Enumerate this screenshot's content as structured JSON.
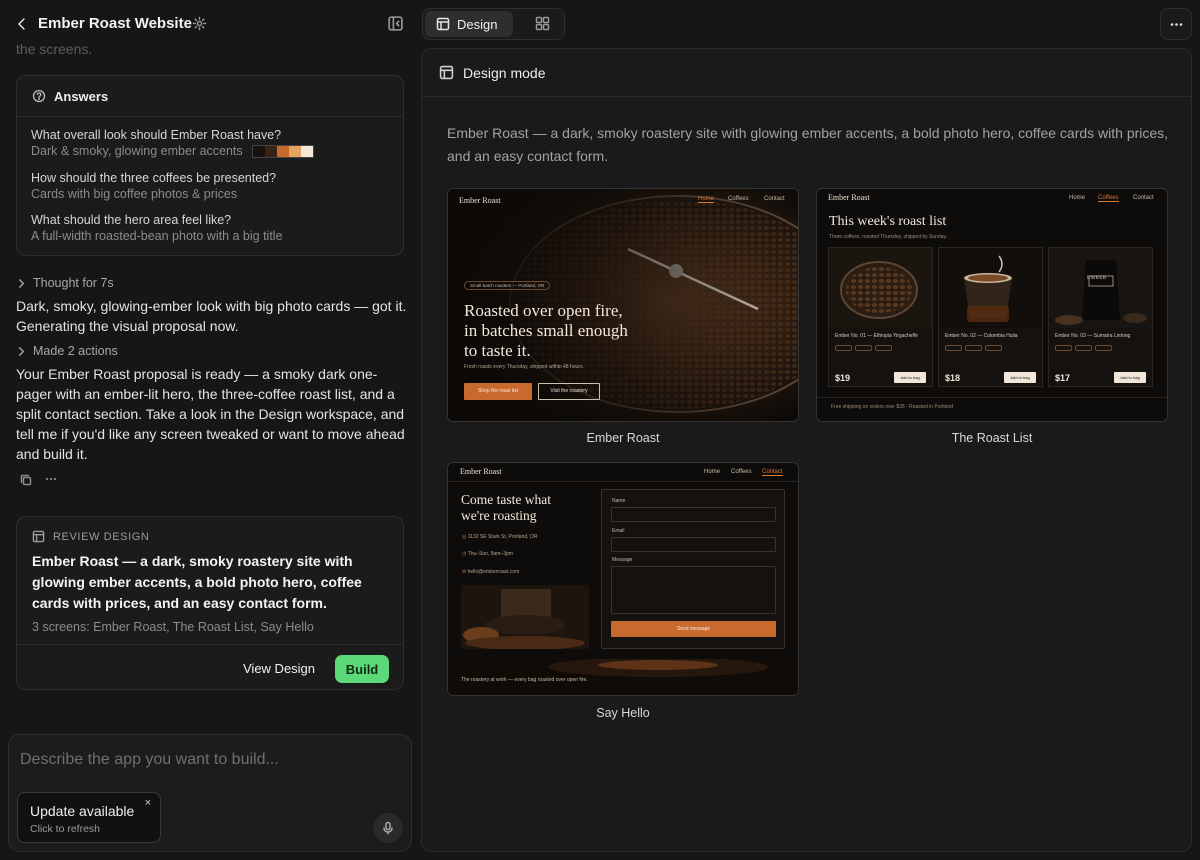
{
  "project": {
    "title": "Ember Roast Website"
  },
  "chat": {
    "cut_text": "the screens.",
    "answers": {
      "heading": "Answers",
      "items": [
        {
          "question": "What overall look should Ember Roast have?",
          "answer": "Dark & smoky, glowing ember accents",
          "swatches": [
            "#161210",
            "#3a2314",
            "#c66a2c",
            "#e3a45f",
            "#f3e8d8"
          ]
        },
        {
          "question": "How should the three coffees be presented?",
          "answer": "Cards with big coffee photos & prices"
        },
        {
          "question": "What should the hero area feel like?",
          "answer": "A full-width roasted-bean photo with a big title"
        }
      ]
    },
    "thought_label": "Thought for 7s",
    "message_1": "Dark, smoky, glowing-ember look with big photo cards — got it. Generating the visual proposal now.",
    "actions_label": "Made 2 actions",
    "message_2": "Your Ember Roast proposal is ready — a smoky dark one-pager with an ember-lit hero, the three-coffee roast list, and a split contact section. Take a look in the Design workspace, and tell me if you'd like any screen tweaked or want to move ahead and build it.",
    "review": {
      "tag": "REVIEW DESIGN",
      "title": "Ember Roast — a dark, smoky roastery site with glowing ember accents, a bold photo hero, coffee cards with prices, and an easy contact form.",
      "subtitle": "3 screens: Ember Roast, The Roast List, Say Hello",
      "view_label": "View Design",
      "build_label": "Build"
    },
    "composer": {
      "placeholder": "Describe the app you want to build...",
      "toast_title": "Update available",
      "toast_sub": "Click to refresh",
      "toast_close": "×"
    }
  },
  "topbar": {
    "design_tab": "Design"
  },
  "workspace": {
    "heading": "Design mode",
    "description": "Ember Roast — a dark, smoky roastery site with glowing ember accents, a bold photo hero, coffee cards with prices, and an easy contact form.",
    "colors": {
      "ember": "#d8793c",
      "cream": "#f1e6d8",
      "build_green": "#5dd879"
    },
    "screens": [
      {
        "label": "Ember Roast",
        "logo": "Ember Roast",
        "nav": [
          "Home",
          "Coffees",
          "Contact"
        ],
        "badge": "Small-batch roasters — Portland, OR",
        "headline": [
          "Roasted over open fire,",
          "in batches small enough",
          "to taste it."
        ],
        "sub": "Fresh roasts every Thursday, shipped within 48 hours.",
        "cta_primary": "Shop the roast list",
        "cta_secondary": "Visit the roastery"
      },
      {
        "label": "The Roast List",
        "logo": "Ember Roast",
        "nav": [
          "Home",
          "Coffees",
          "Contact"
        ],
        "heading": "This week's roast list",
        "sub": "Three coffees, roasted Thursday, shipped by Sunday.",
        "coffees": [
          {
            "name": "Ember No. 01 — Ethiopia Yirgacheffe",
            "price": "$19",
            "button": "Add to bag"
          },
          {
            "name": "Ember No. 02 — Colombia Huila",
            "price": "$18",
            "button": "Add to bag"
          },
          {
            "name": "Ember No. 03 — Sumatra Lintong",
            "price": "$17",
            "button": "Add to bag"
          }
        ],
        "footnote": "Free shipping on orders over $35 · Roasted in Portland"
      },
      {
        "label": "Say Hello",
        "logo": "Ember Roast",
        "nav": [
          "Home",
          "Coffees",
          "Contact"
        ],
        "heading": [
          "Come taste what",
          "we're roasting"
        ],
        "info": [
          "1132 SE Stark St, Portland, OR",
          "Thu–Sun, 8am–3pm",
          "hello@emberroast.com"
        ],
        "form_labels": [
          "Name",
          "Email",
          "Message"
        ],
        "submit": "Send message",
        "footer": "The roastery at work — every bag roasted over open fire."
      }
    ]
  }
}
